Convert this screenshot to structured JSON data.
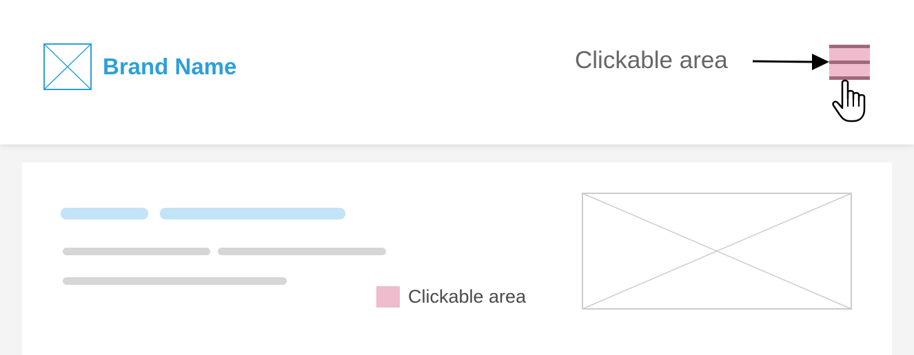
{
  "header": {
    "brand_name": "Brand Name",
    "annotation_label": "Clickable area",
    "brand_color": "#2d9fd8",
    "menu_icon": "hamburger-menu-icon",
    "cursor_icon": "hand-pointer-icon"
  },
  "card": {
    "legend_label": "Clickable area",
    "highlight_color": "#eebccd",
    "image_icon": "image-placeholder-icon"
  }
}
